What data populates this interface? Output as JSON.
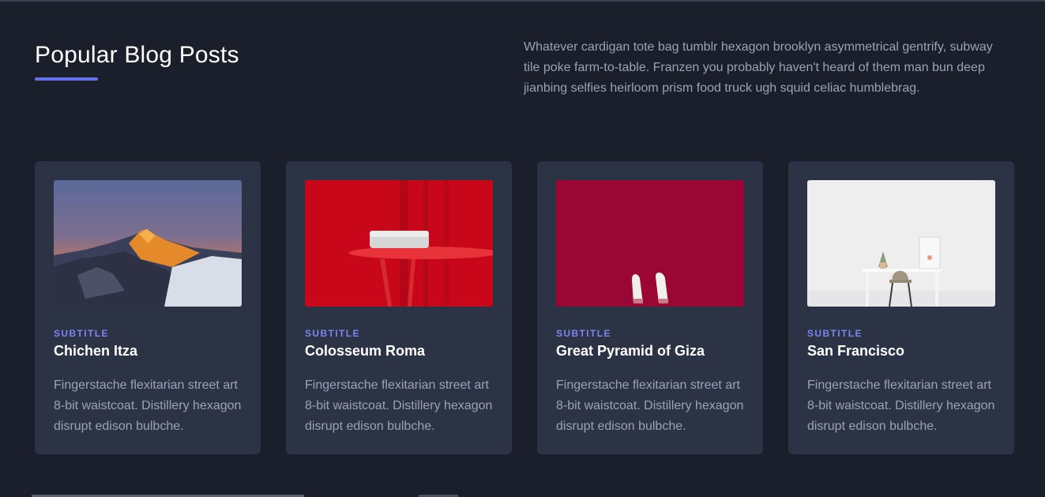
{
  "header": {
    "title": "Popular Blog Posts",
    "intro": "Whatever cardigan tote bag tumblr hexagon brooklyn asymmetrical gentrify, subway tile poke farm-to-table. Franzen you probably haven't heard of them man bun deep jianbing selfies heirloom prism food truck ugh squid celiac humblebrag."
  },
  "colors": {
    "background": "#1b1f2b",
    "card": "#2c3345",
    "accent": "#6673ea"
  },
  "cards": [
    {
      "subtitle": "SUBTITLE",
      "title": "Chichen Itza",
      "text": "Fingerstache flexitarian street art 8-bit waistcoat. Distillery hexagon disrupt edison bulbche.",
      "image": "mountain-sunset-image"
    },
    {
      "subtitle": "SUBTITLE",
      "title": "Colosseum Roma",
      "text": "Fingerstache flexitarian street art 8-bit waistcoat. Distillery hexagon disrupt edison bulbche.",
      "image": "red-table-image"
    },
    {
      "subtitle": "SUBTITLE",
      "title": "Great Pyramid of Giza",
      "text": "Fingerstache flexitarian street art 8-bit waistcoat. Distillery hexagon disrupt edison bulbche.",
      "image": "shoes-on-red-image"
    },
    {
      "subtitle": "SUBTITLE",
      "title": "San Francisco",
      "text": "Fingerstache flexitarian street art 8-bit waistcoat. Distillery hexagon disrupt edison bulbche.",
      "image": "white-desk-image"
    }
  ]
}
